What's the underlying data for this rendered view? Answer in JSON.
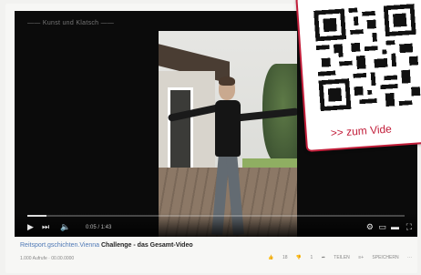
{
  "video": {
    "overlay_title": "—— Kunst und Klatsch ——",
    "progress": 0.05,
    "time": "0:05 / 1:43"
  },
  "qr": {
    "link_text": ">> zum Vide"
  },
  "info": {
    "channel": "Reitsport.gschichten.Vienna",
    "title": "Challenge - das Gesamt-Video",
    "sub": "1.000 Aufrufe · 00.00.0000",
    "likes": "18",
    "dislikes": "1",
    "share": "TEILEN",
    "save": "SPEICHERN",
    "more": "···"
  },
  "colors": {
    "accent": "#c21e3a",
    "link": "#4f79b6"
  }
}
